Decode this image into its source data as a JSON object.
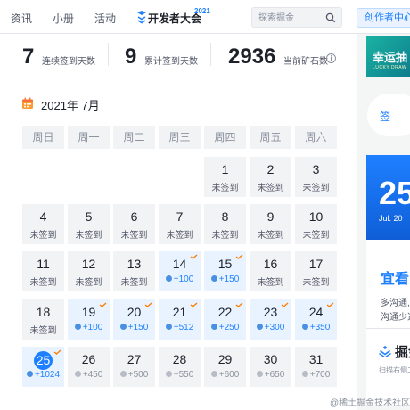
{
  "nav": {
    "items": [
      "资讯",
      "小册",
      "活动"
    ],
    "brand": "开发者大会",
    "brand_year": "2021",
    "search_placeholder": "探索掘金",
    "creator_button": "创作者中心"
  },
  "stats": [
    {
      "value": "7",
      "label": "连续签到天数"
    },
    {
      "value": "9",
      "label": "累计签到天数"
    },
    {
      "value": "2936",
      "label": "当前矿石数"
    }
  ],
  "calendar": {
    "month": "2021年 7月",
    "weekdays": [
      "周日",
      "周一",
      "周二",
      "周三",
      "周四",
      "周五",
      "周六"
    ],
    "days": [
      {
        "day": "1",
        "status": "未签到"
      },
      {
        "day": "2",
        "status": "未签到"
      },
      {
        "day": "3",
        "status": "未签到"
      },
      {
        "day": "4",
        "status": "未签到"
      },
      {
        "day": "5",
        "status": "未签到"
      },
      {
        "day": "6",
        "status": "未签到"
      },
      {
        "day": "7",
        "status": "未签到"
      },
      {
        "day": "8",
        "status": "未签到"
      },
      {
        "day": "9",
        "status": "未签到"
      },
      {
        "day": "10",
        "status": "未签到"
      },
      {
        "day": "11",
        "status": "未签到"
      },
      {
        "day": "12",
        "status": "未签到"
      },
      {
        "day": "13",
        "status": "未签到"
      },
      {
        "day": "14",
        "status": "+100"
      },
      {
        "day": "15",
        "status": "+150"
      },
      {
        "day": "16",
        "status": "未签到"
      },
      {
        "day": "17",
        "status": "未签到"
      },
      {
        "day": "18",
        "status": "未签到"
      },
      {
        "day": "19",
        "status": "+100"
      },
      {
        "day": "20",
        "status": "+150"
      },
      {
        "day": "21",
        "status": "+512"
      },
      {
        "day": "22",
        "status": "+250"
      },
      {
        "day": "23",
        "status": "+300"
      },
      {
        "day": "24",
        "status": "+350"
      },
      {
        "day": "25",
        "status": "+1024"
      },
      {
        "day": "26",
        "status": "+450"
      },
      {
        "day": "27",
        "status": "+500"
      },
      {
        "day": "28",
        "status": "+550"
      },
      {
        "day": "29",
        "status": "+600"
      },
      {
        "day": "30",
        "status": "+650"
      },
      {
        "day": "31",
        "status": "+700"
      }
    ]
  },
  "sidebar": {
    "banner_title": "幸运抽",
    "banner_sub": "LUCKY DRAW",
    "pill_label": "签",
    "date_big": "25",
    "date_small": "Jul. 20",
    "yi_title": "宜看",
    "yi_lines": [
      "多沟通,",
      "沟通少迈"
    ],
    "app_name": "掘金",
    "app_sub": "扫描右侧二"
  },
  "watermark": "@稀土掘金技术社区",
  "colors": {
    "accent": "#1e80ff",
    "signed_bg": "#e8f3ff",
    "cell_bg": "#f2f3f5",
    "checkmark": "#ff7d00"
  }
}
